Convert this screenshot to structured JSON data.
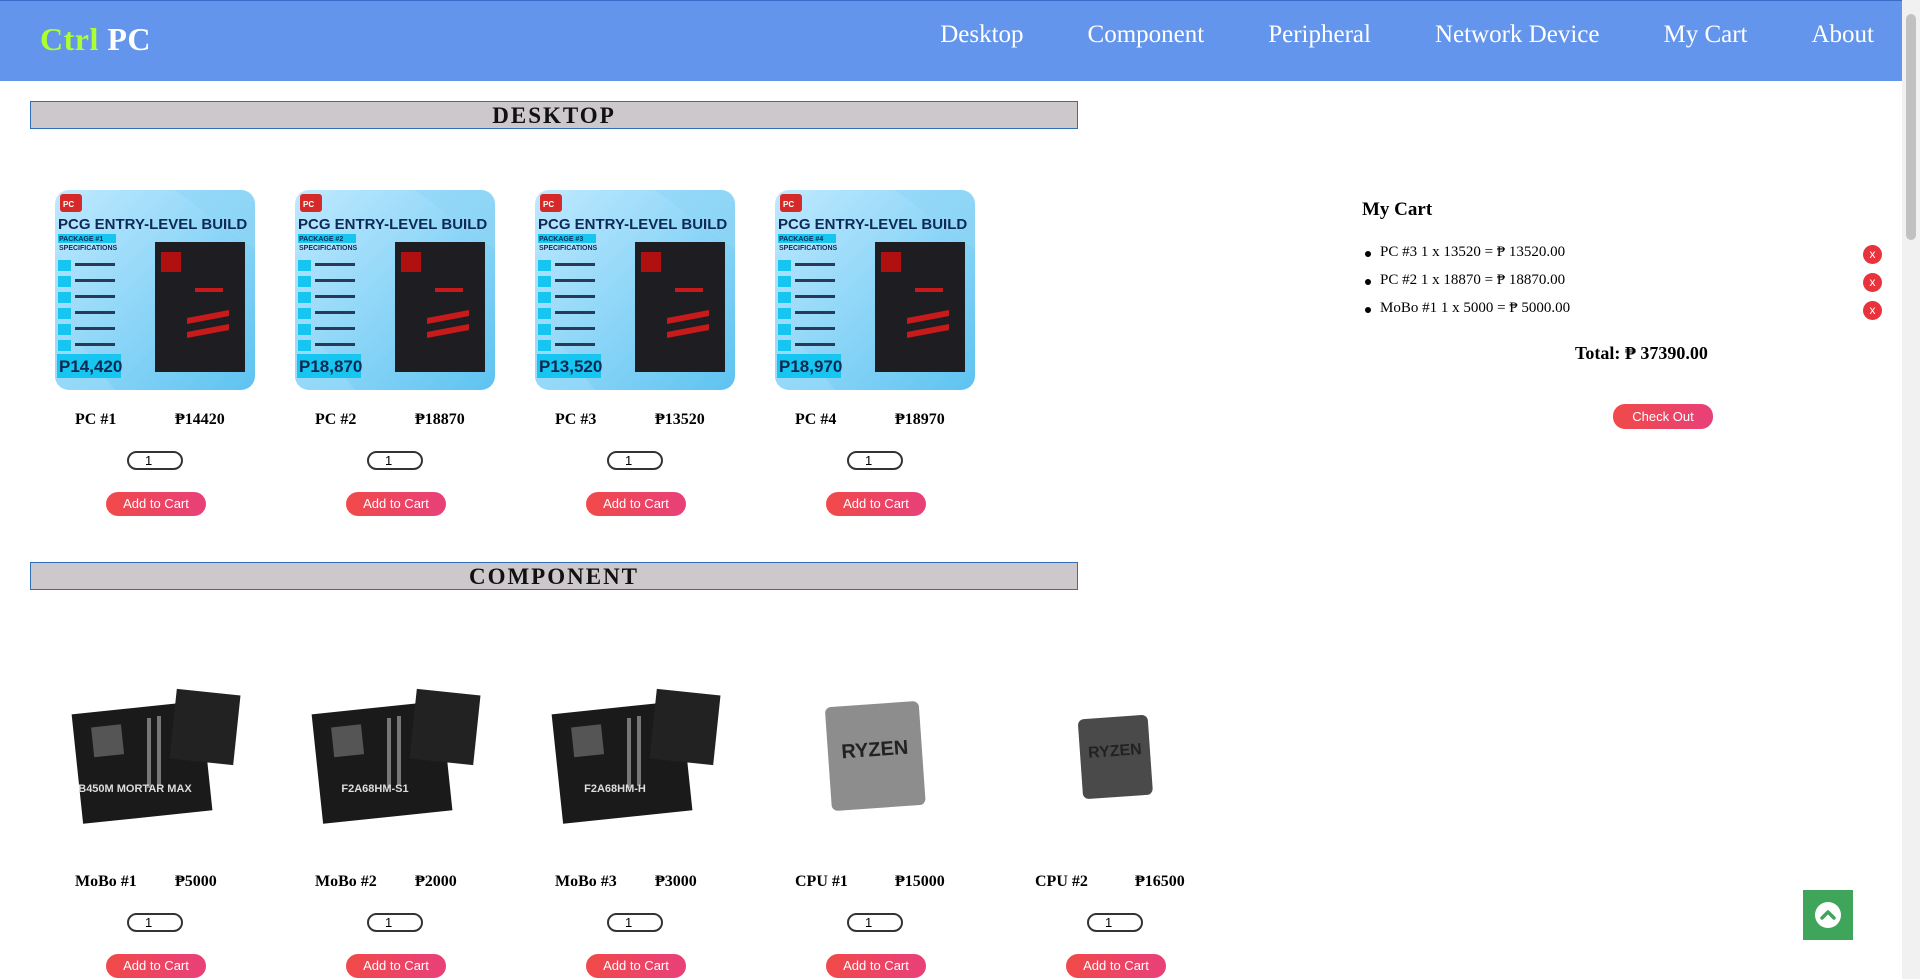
{
  "logo": {
    "part1": "Ctrl",
    "part2": "PC"
  },
  "nav": [
    "Desktop",
    "Component",
    "Peripheral",
    "Network Device",
    "My Cart",
    "About"
  ],
  "sections": {
    "desktop": "DESKTOP",
    "component": "COMPONENT"
  },
  "desktops": [
    {
      "name": "PC #1",
      "price": "₱14420",
      "qty": "1",
      "add_label": "Add to Cart",
      "pkg": "PACKAGE #1",
      "tag": "P14,420"
    },
    {
      "name": "PC #2",
      "price": "₱18870",
      "qty": "1",
      "add_label": "Add to Cart",
      "pkg": "PACKAGE #2",
      "tag": "P18,870"
    },
    {
      "name": "PC #3",
      "price": "₱13520",
      "qty": "1",
      "add_label": "Add to Cart",
      "pkg": "PACKAGE #3",
      "tag": "P13,520"
    },
    {
      "name": "PC #4",
      "price": "₱18970",
      "qty": "1",
      "add_label": "Add to Cart",
      "pkg": "PACKAGE #4",
      "tag": "P18,970"
    }
  ],
  "pcg_title": "PCG ENTRY-LEVEL BUILD",
  "pcg_spec": "SPECIFICATIONS",
  "components": [
    {
      "name": "MoBo #1",
      "price": "₱5000",
      "qty": "1",
      "add_label": "Add to Cart",
      "icon": "motherboard-msi-image",
      "text": "B450M MORTAR MAX"
    },
    {
      "name": "MoBo #2",
      "price": "₱2000",
      "qty": "1",
      "add_label": "Add to Cart",
      "icon": "motherboard-box-image",
      "text": "F2A68HM-S1"
    },
    {
      "name": "MoBo #3",
      "price": "₱3000",
      "qty": "1",
      "add_label": "Add to Cart",
      "icon": "motherboard-gigabyte-image",
      "text": "F2A68HM-H"
    },
    {
      "name": "CPU #1",
      "price": "₱15000",
      "qty": "1",
      "add_label": "Add to Cart",
      "icon": "ryzen-cpu-image",
      "text": "RYZEN"
    },
    {
      "name": "CPU #2",
      "price": "₱16500",
      "qty": "1",
      "add_label": "Add to Cart",
      "icon": "ryzen-pro-cpu-image",
      "text": "RYZEN"
    }
  ],
  "cart": {
    "title": "My Cart",
    "items": [
      {
        "text": "PC #3 1 x 13520 = ₱ 13520.00",
        "remove": "x"
      },
      {
        "text": "PC #2 1 x 18870 = ₱ 18870.00",
        "remove": "x"
      },
      {
        "text": "MoBo #1 1 x 5000 = ₱ 5000.00",
        "remove": "x"
      }
    ],
    "total": "Total: ₱ 37390.00",
    "checkout_label": "Check Out"
  },
  "colors": {
    "header": "#6495ed",
    "logo_accent": "#adff2f",
    "button": "#f04a4a",
    "to_top": "#3fa55a"
  }
}
